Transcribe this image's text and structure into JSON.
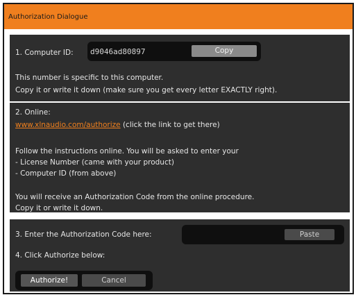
{
  "window": {
    "title": "Authorization Dialogue"
  },
  "section1": {
    "label": "1. Computer ID:",
    "computer_id": "d9046ad80897",
    "copy_button": "Copy",
    "info_line1": "This number is specific to this computer.",
    "info_line2": "Copy it or write it down (make sure you get every letter EXACTLY right)."
  },
  "section2": {
    "label": "2. Online:",
    "link": "www.xlnaudio.com/authorize",
    "link_hint": " (click the link to get there)",
    "instructions": "Follow the instructions online. You will be asked to enter your",
    "bullet1": "- License Number (came with your product)",
    "bullet2": "- Computer ID (from above)",
    "receive_line1": "You will receive an Authorization Code from the online procedure.",
    "receive_line2": "Copy it or write it down."
  },
  "section3": {
    "label": "3. Enter the Authorization Code here:",
    "code_value": "",
    "paste_button": "Paste"
  },
  "section4": {
    "label": "4. Click Authorize below:",
    "authorize_button": "Authorize!",
    "cancel_button": "Cancel"
  },
  "colors": {
    "accent": "#f07f1e",
    "panel": "#2e2e2e",
    "field": "#0f0f0f"
  }
}
